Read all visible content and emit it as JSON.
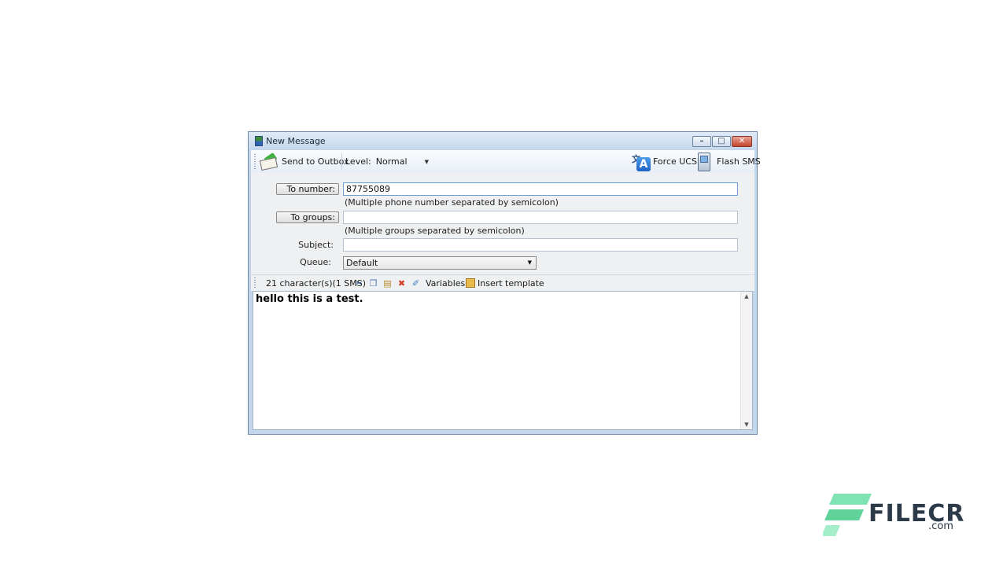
{
  "window": {
    "title": "New Message"
  },
  "toolbar": {
    "send_label": "Send to Outbox",
    "level_label": "Level:",
    "level_value": "Normal",
    "force_ucs2_label": "Force UCS2",
    "flash_sms_label": "Flash SMS"
  },
  "form": {
    "to_number_label": "To number:",
    "to_number_value": "87755089",
    "to_number_hint": "(Multiple phone number separated by semicolon)",
    "to_groups_label": "To groups:",
    "to_groups_value": "",
    "to_groups_hint": "(Multiple groups separated by semicolon)",
    "subject_label": "Subject:",
    "subject_value": "",
    "queue_label": "Queue:",
    "queue_value": "Default"
  },
  "edit_toolbar": {
    "char_count": "21 character(s)(1 SMS)",
    "variables_label": "Variables",
    "insert_template_label": "Insert template"
  },
  "editor": {
    "text": "hello this is a test."
  },
  "watermark": {
    "name": "FILECR",
    "domain": ".com"
  },
  "colors": {
    "accent": "#3eb33e",
    "close": "#c4462d",
    "brand": "#5fd39a"
  }
}
